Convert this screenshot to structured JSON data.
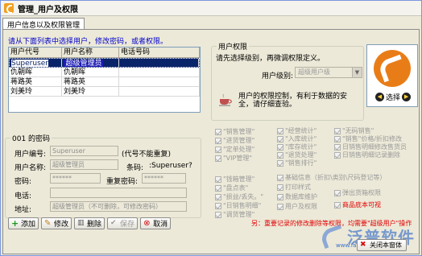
{
  "window": {
    "title": "管理_用户及权限"
  },
  "tabs": [
    {
      "label": "用户信息以及权限管理"
    }
  ],
  "left": {
    "hint": "请从下面列表中选择用户，修改密码，或者权限。",
    "table": {
      "headers": [
        "用户代号",
        "用户名称",
        "电话号码"
      ],
      "rows": [
        {
          "code": "Superuser",
          "name": "超级管理员",
          "phone": "",
          "selected": true
        },
        {
          "code": "仇朝晖",
          "name": "仇朝晖",
          "phone": ""
        },
        {
          "code": "蒋路英",
          "name": "蒋路英",
          "phone": ""
        },
        {
          "code": "刘美玲",
          "name": "刘美玲",
          "phone": ""
        }
      ]
    },
    "pwd_group": {
      "title": "001 的密码",
      "user_code_label": "用户编号:",
      "user_code_value": "Superuser",
      "user_code_note": "(代号不能重复)",
      "user_name_label": "用户名称:",
      "user_name_value": "超级管理员",
      "barcode_label": "条码:",
      "barcode_value": ":Superuser?",
      "password_label": "密码:",
      "password_value": "******",
      "repeat_label": "重复密码:",
      "repeat_value": "******",
      "phone_label": "电话:",
      "phone_value": "",
      "address_label": "地址:",
      "address_value": "超级管理员（不可删除，可修改密码）"
    },
    "buttons": {
      "add": "添加",
      "edit": "修改",
      "delete": "删除",
      "save": "保存",
      "cancel": "取消"
    }
  },
  "right": {
    "group_title": "用户权限",
    "level_hint": "请先选择级别，再微调权限定义。",
    "level_label": "用户级别:",
    "level_value": "超级用户级",
    "tea_text": "用户的权限控制，有利于数据的安全，请仔细查验。",
    "choose_label": "选择",
    "perms": [
      {
        "label": "\"销售管理\"",
        "checked": true
      },
      {
        "label": "\"进货管理\"",
        "checked": true
      },
      {
        "label": "\"定单处理\"",
        "checked": true
      },
      {
        "label": "\"VIP管理\"",
        "checked": true
      },
      {
        "label": "\"经营统计\"",
        "checked": true
      },
      {
        "label": "\"入库统计\"",
        "checked": true
      },
      {
        "label": "\"库存统计\"",
        "checked": true
      },
      {
        "label": "\"退货处理\"",
        "checked": true
      },
      {
        "label": "\"销售排行\"",
        "checked": true
      },
      {
        "label": "\"无码销售\"",
        "checked": true
      },
      {
        "label": "\"销售\"价格/折扣修改",
        "checked": true
      },
      {
        "label": "日销售明细修改售货员",
        "checked": true
      },
      {
        "label": "日销售明细记录删除",
        "checked": true
      },
      {
        "label": "\"钱箱管理\"",
        "checked": true
      },
      {
        "label": "\"盘点表\"",
        "checked": true
      },
      {
        "label": "\"损益/丢失。\"",
        "checked": true
      },
      {
        "label": "\"日销售明细\"",
        "checked": true
      },
      {
        "label": "\"调货管理\"",
        "checked": true
      },
      {
        "label": "基础信息（折扣\\类别\\尺码登记等）",
        "checked": true
      },
      {
        "label": "打印样式",
        "checked": true
      },
      {
        "label": "数据库维护",
        "checked": true
      },
      {
        "label": "用户及权限",
        "checked": true
      },
      {
        "label": "弹出货箱权限",
        "checked": true
      },
      {
        "label": "商品底本可视",
        "checked": true
      }
    ],
    "note": "另：重要记录的修改删除等权限，均需要\"超级用户\"操作",
    "close_label": "关闭本窗体"
  },
  "watermark": {
    "text": "泛普软件",
    "url": "www.fanpusoft.com"
  },
  "colors": {
    "selection": "#0a246a",
    "note_red": "#e00000",
    "logo_orange": "#e87d18"
  }
}
